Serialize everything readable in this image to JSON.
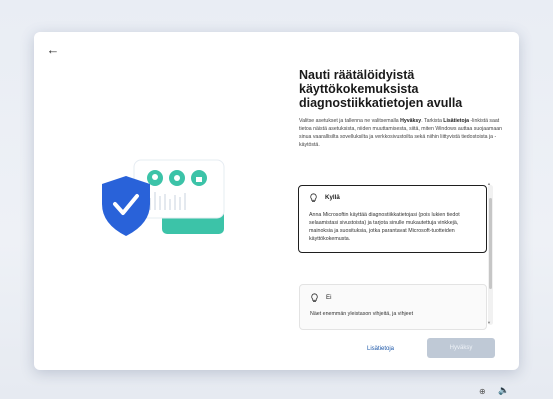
{
  "title": "Nauti räätälöidyistä käyttökokemuksista diagnostiikkatietojen avulla",
  "description_parts": {
    "p1": "Valitse asetukset ja tallenna ne valitsemalla ",
    "b1": "Hyväksy",
    "p2": ". Tarkista ",
    "b2": "Lisätietoja",
    "p3": " -linkistä saat tietoa näistä asetuksista, niiden muuttamisesta, siitä, miten Windows auttaa suojaamaan sinua vaarallisilta sovelluksilta ja verkkosivustoilta sekä niihin liittyvistä tiedostoista ja -käytöstä."
  },
  "options": [
    {
      "label": "Kyllä",
      "icon": "lightbulb-icon",
      "text": "Anna Microsoftin käyttää diagnostiikkatietojasi (pois lukien tiedot selaamistasi sivustoista) ja tarjota sinulle mukautettuja vinkkejä, mainoksia ja suosituksia, jotka parantavat Microsoft-tuotteiden käyttökokemusta.",
      "selected": true
    },
    {
      "label": "Ei",
      "icon": "lightbulb-icon",
      "text": "Näet enemmän yleistason vihjeitä, ja vihjeet",
      "selected": false
    }
  ],
  "link_label": "Lisätietoja",
  "accept_label": "Hyväksy",
  "colors": {
    "accent": "#2962d9",
    "card": "#3cc3a8",
    "button_disabled": "#bfc9d6"
  }
}
